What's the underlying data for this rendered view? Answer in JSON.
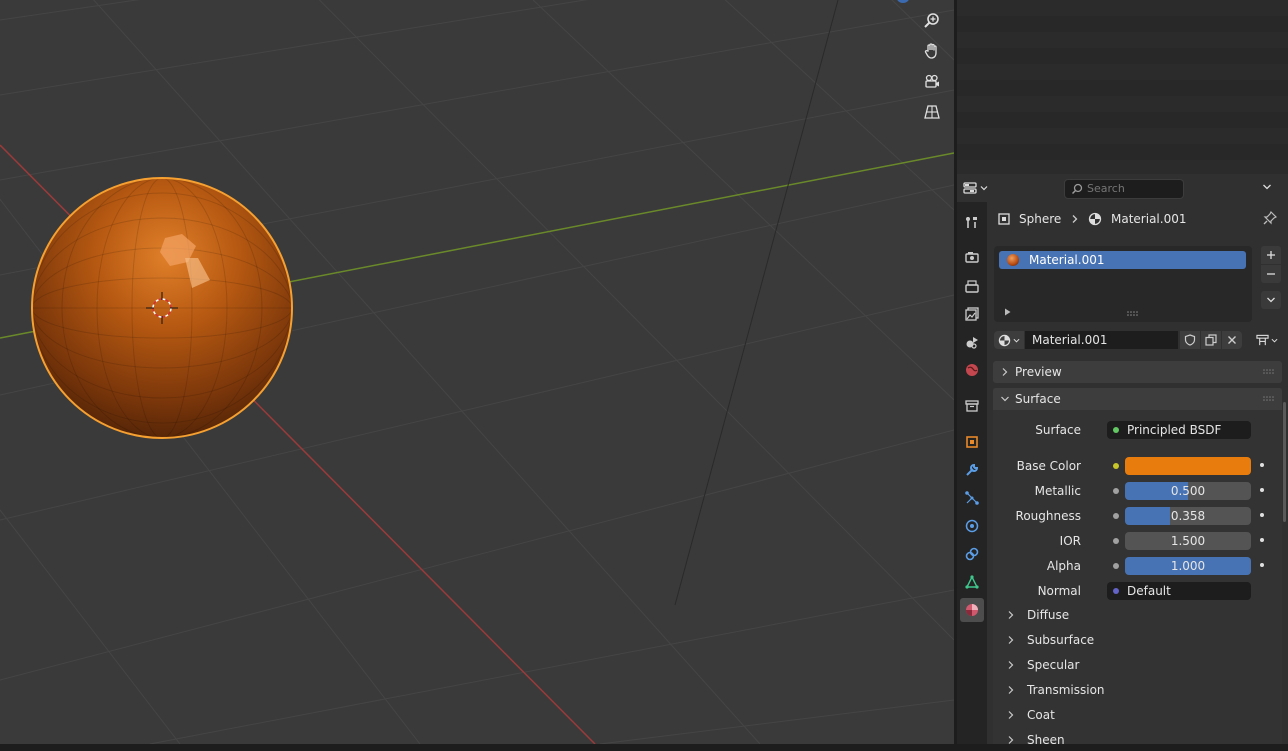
{
  "properties": {
    "search": {
      "placeholder": "Search"
    },
    "breadcrumb": {
      "object": "Sphere",
      "material": "Material.001"
    },
    "material_slots": [
      {
        "name": "Material.001"
      }
    ],
    "material_name": "Material.001",
    "panels": {
      "preview": "Preview",
      "surface": "Surface"
    },
    "surface": {
      "shader_label": "Surface",
      "shader_value": "Principled BSDF",
      "base_color_label": "Base Color",
      "base_color_hex": "#e87d0d",
      "metallic": {
        "label": "Metallic",
        "value": "0.500",
        "fraction": 0.5
      },
      "roughness": {
        "label": "Roughness",
        "value": "0.358",
        "fraction": 0.358
      },
      "ior": {
        "label": "IOR",
        "value": "1.500",
        "fraction": 0
      },
      "alpha": {
        "label": "Alpha",
        "value": "1.000",
        "fraction": 1.0
      },
      "normal": {
        "label": "Normal",
        "value": "Default"
      }
    },
    "subpanels": [
      "Diffuse",
      "Subsurface",
      "Specular",
      "Transmission",
      "Coat",
      "Sheen"
    ]
  },
  "colors": {
    "accent": "#4772b3",
    "selection_outline": "#f5a030",
    "x_axis": "#9b3a3a",
    "y_axis": "#6a8a2a",
    "shader_socket": "#63c763",
    "color_socket": "#c7c729",
    "float_socket": "#a1a1a1",
    "vector_socket": "#6363c7"
  },
  "icons": {
    "viewport_nav": [
      "zoom-icon",
      "hand-pan-icon",
      "camera-icon",
      "grid-perspective-icon"
    ],
    "property_tabs": [
      "tool-icon",
      "render-icon",
      "output-icon",
      "view-layer-icon",
      "scene-icon",
      "world-icon",
      "collection-icon",
      "object-icon",
      "modifier-icon",
      "particles-icon",
      "physics-icon",
      "constraints-icon",
      "data-icon",
      "material-icon"
    ]
  }
}
